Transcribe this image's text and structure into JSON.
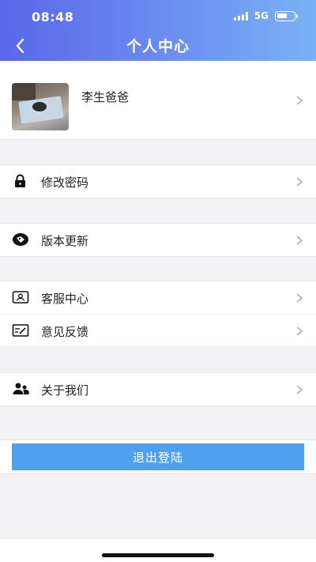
{
  "status_bar": {
    "time": "08:48",
    "network": "5G"
  },
  "header": {
    "title": "个人中心"
  },
  "profile": {
    "name": "李生爸爸"
  },
  "groups": [
    [
      {
        "label": "修改密码",
        "icon": "lock-icon"
      }
    ],
    [
      {
        "label": "版本更新",
        "icon": "tag-icon"
      }
    ],
    [
      {
        "label": "客服中心",
        "icon": "customer-service-icon"
      },
      {
        "label": "意见反馈",
        "icon": "feedback-icon"
      }
    ],
    [
      {
        "label": "关于我们",
        "icon": "users-icon"
      }
    ]
  ],
  "logout_label": "退出登陆",
  "colors": {
    "header_start": "#5a67e8",
    "header_end": "#7ab2f5",
    "logout_button": "#4fa1ee",
    "background": "#f2f2f5"
  }
}
